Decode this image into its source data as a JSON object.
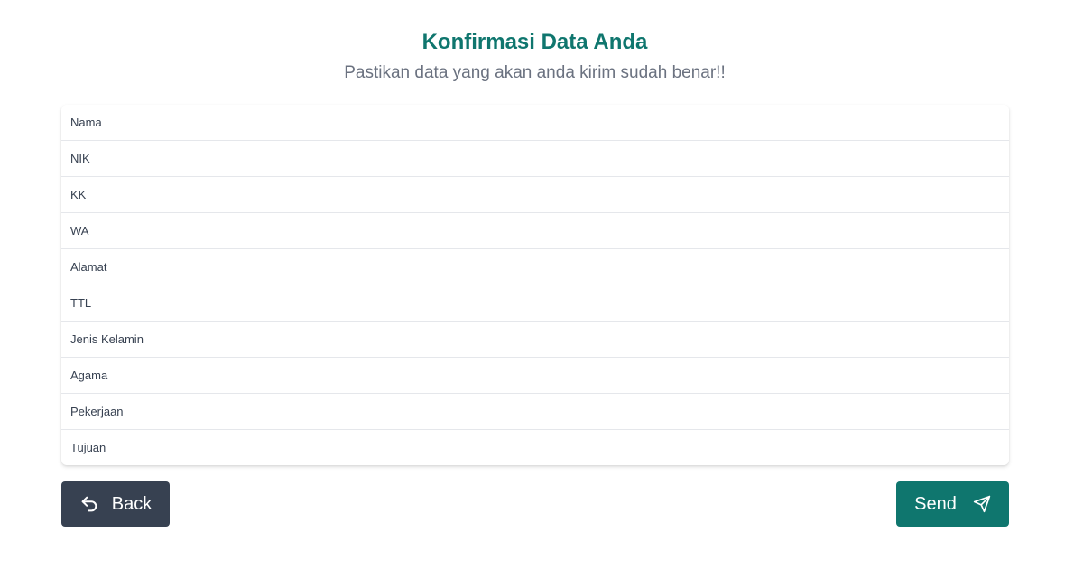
{
  "header": {
    "title": "Konfirmasi Data Anda",
    "subtitle": "Pastikan data yang akan anda kirim sudah benar!!"
  },
  "fields": [
    {
      "label": "Nama"
    },
    {
      "label": "NIK"
    },
    {
      "label": "KK"
    },
    {
      "label": "WA"
    },
    {
      "label": "Alamat"
    },
    {
      "label": "TTL"
    },
    {
      "label": "Jenis Kelamin"
    },
    {
      "label": "Agama"
    },
    {
      "label": "Pekerjaan"
    },
    {
      "label": "Tujuan"
    }
  ],
  "actions": {
    "back_label": "Back",
    "back_icon": "return-arrow-icon",
    "send_label": "Send",
    "send_icon": "paper-plane-icon"
  },
  "colors": {
    "primary": "#0f766e",
    "secondary": "#374151",
    "subtitle": "#6b7280"
  }
}
